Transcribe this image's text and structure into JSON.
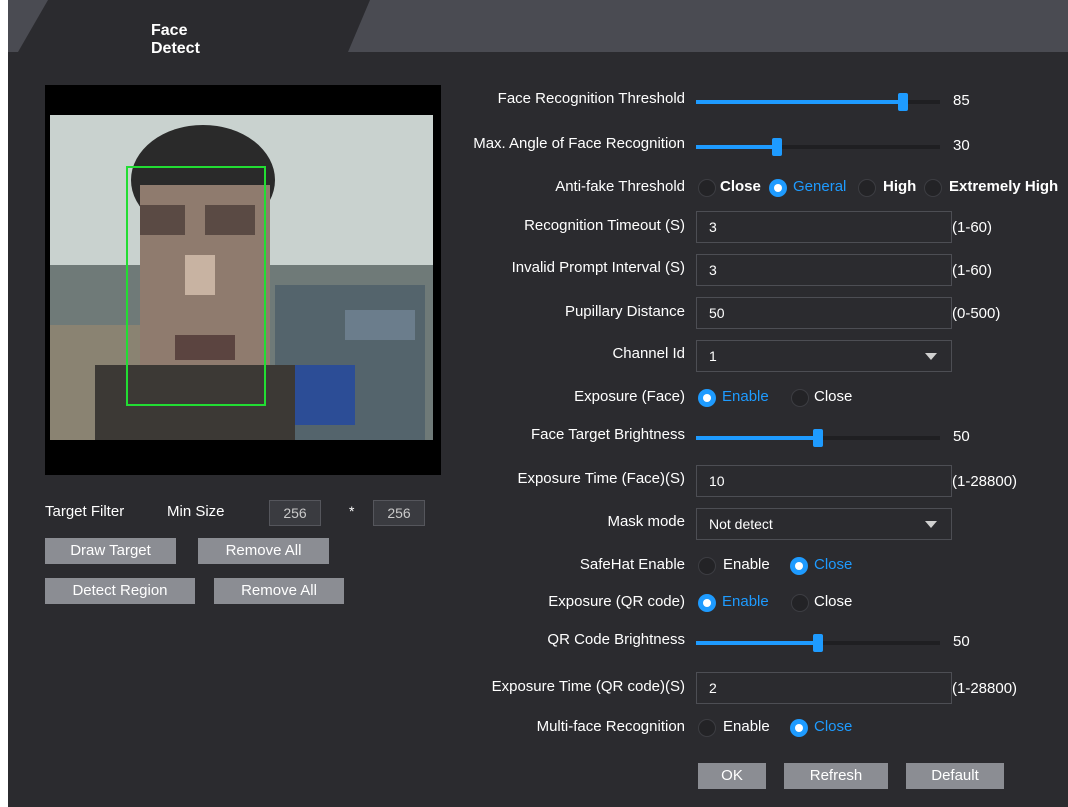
{
  "tab": {
    "title": "Face Detect"
  },
  "target_filter": {
    "label": "Target Filter",
    "min_size_label": "Min Size",
    "width": "256",
    "separator": "*",
    "height": "256",
    "draw_target": "Draw Target",
    "remove_all_1": "Remove All",
    "detect_region": "Detect Region",
    "remove_all_2": "Remove All"
  },
  "form": {
    "face_threshold": {
      "label": "Face Recognition Threshold",
      "value": "85",
      "fraction": 0.85
    },
    "max_angle": {
      "label": "Max. Angle of Face Recognition",
      "value": "30",
      "fraction": 0.33
    },
    "anti_fake": {
      "label": "Anti-fake Threshold",
      "options": [
        "Close",
        "General",
        "High",
        "Extremely High"
      ],
      "selected": "General"
    },
    "recognition_timeout": {
      "label": "Recognition Timeout (S)",
      "value": "3",
      "range": "(1-60)"
    },
    "invalid_prompt": {
      "label": "Invalid Prompt Interval (S)",
      "value": "3",
      "range": "(1-60)"
    },
    "pupillary": {
      "label": "Pupillary Distance",
      "value": "50",
      "range": "(0-500)"
    },
    "channel": {
      "label": "Channel Id",
      "value": "1"
    },
    "exposure_face": {
      "label": "Exposure (Face)",
      "options": [
        "Enable",
        "Close"
      ],
      "selected": "Enable"
    },
    "face_brightness": {
      "label": "Face Target Brightness",
      "value": "50",
      "fraction": 0.5
    },
    "exposure_time_face": {
      "label": "Exposure Time (Face)(S)",
      "value": "10",
      "range": "(1-28800)"
    },
    "mask_mode": {
      "label": "Mask mode",
      "value": "Not detect"
    },
    "safehat": {
      "label": "SafeHat Enable",
      "options": [
        "Enable",
        "Close"
      ],
      "selected": "Close"
    },
    "exposure_qr": {
      "label": "Exposure (QR code)",
      "options": [
        "Enable",
        "Close"
      ],
      "selected": "Enable"
    },
    "qr_brightness": {
      "label": "QR Code Brightness",
      "value": "50",
      "fraction": 0.5
    },
    "exposure_time_qr": {
      "label": "Exposure Time (QR code)(S)",
      "value": "2",
      "range": "(1-28800)"
    },
    "multi_face": {
      "label": "Multi-face Recognition",
      "options": [
        "Enable",
        "Close"
      ],
      "selected": "Close"
    }
  },
  "buttons": {
    "ok": "OK",
    "refresh": "Refresh",
    "default": "Default"
  },
  "colors": {
    "accent": "#1e9bff",
    "background": "#2b2b2f",
    "face_box": "#22dd33"
  }
}
